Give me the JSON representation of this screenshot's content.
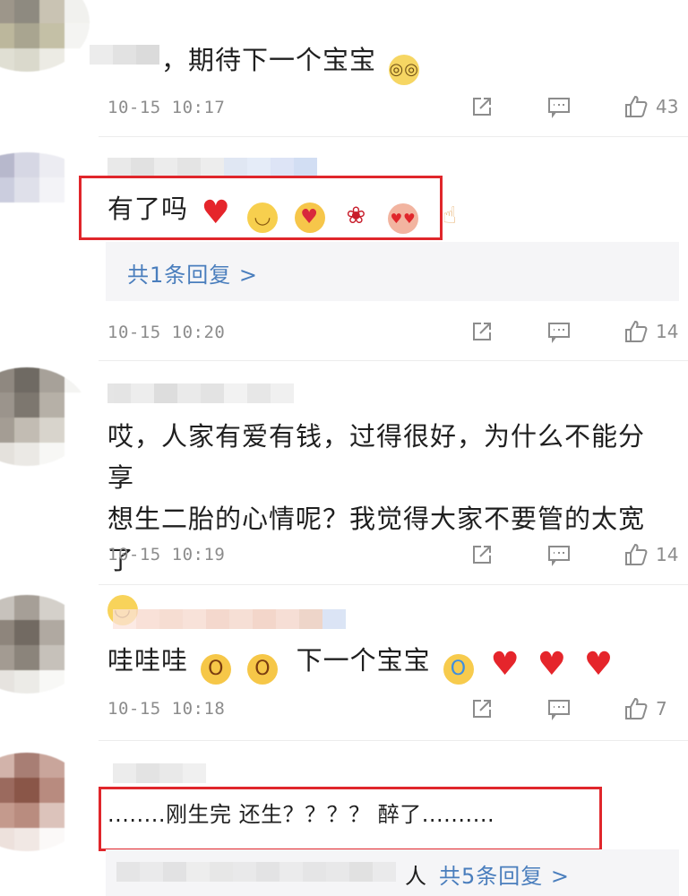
{
  "comments": [
    {
      "text": "，期待下一个宝宝",
      "time": "10-15 10:17",
      "likes": "43"
    },
    {
      "text": "有了吗",
      "time": "10-15 10:20",
      "likes": "14",
      "reply_count": "共1条回复 >"
    },
    {
      "line1": "哎，人家有爱有钱，过得很好，为什么不能分享",
      "line2": "想生二胎的心情呢？我觉得大家不要管的太宽了",
      "time": "10-15 10:19",
      "likes": "14"
    },
    {
      "text": "哇哇哇",
      "text2": "下一个宝宝",
      "time": "10-15 10:18",
      "likes": "7"
    },
    {
      "text": "........刚生完 还生？？？？ 醉了..........",
      "reply_suffix": "人",
      "reply_count": "共5条回复 >"
    }
  ],
  "colors": {
    "link": "#4a7ebd",
    "highlight": "#e0262b",
    "meta": "#8c8c8c"
  },
  "icons": [
    "share-icon",
    "comment-icon",
    "thumbs-up-icon"
  ]
}
